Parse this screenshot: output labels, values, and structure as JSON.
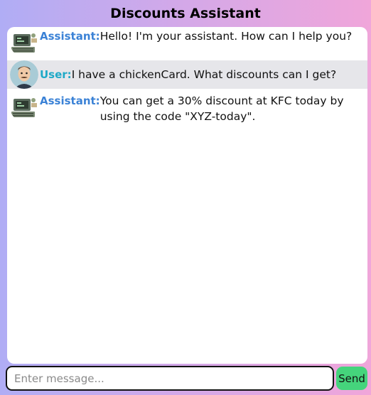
{
  "app": {
    "title": "Discounts Assistant"
  },
  "messages": [
    {
      "role": "assistant",
      "sender": "Assistant:",
      "avatar": "robot-avatar-icon",
      "text": "Hello! I'm your assistant. How can I help you?"
    },
    {
      "role": "user",
      "sender": "User:",
      "avatar": "user-avatar-icon",
      "text": "I have a chickenCard. What discounts can I get?"
    },
    {
      "role": "assistant",
      "sender": "Assistant:",
      "avatar": "robot-avatar-icon",
      "text": "You can get a 30% discount at KFC today by using the code \"XYZ-today\"."
    }
  ],
  "composer": {
    "placeholder": "Enter message...",
    "value": "",
    "send_label": "Send"
  },
  "colors": {
    "assistant_name": "#3b82d6",
    "user_name": "#1fa9c7",
    "send_button": "#45d47c",
    "user_row": "#e6e6ea"
  }
}
